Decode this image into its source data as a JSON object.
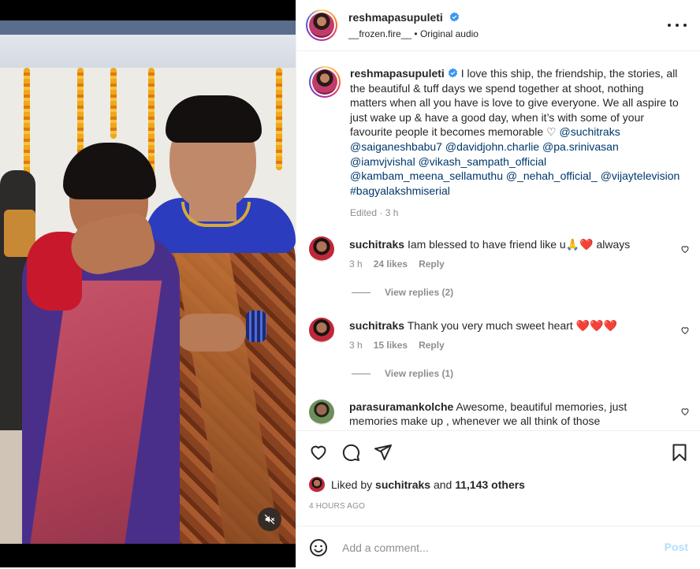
{
  "post": {
    "username": "reshmapasupuleti",
    "audio_user": "__frozen.fire__",
    "audio_sep": " • ",
    "audio_label": "Original audio",
    "caption_parts": [
      {
        "t": "I love this ship, the friendship, the stories, all the beautiful & tuff days we spend together at shoot, nothing matters when all you have is love to give everyone. We all aspire to just wake up & have a good day, when it’s with some of your favourite people it becomes memorable ",
        "tag": false
      },
      {
        "t": "♡ ",
        "tag": false
      },
      {
        "t": "@suchitraks",
        "tag": true
      },
      {
        "t": " ",
        "tag": false
      },
      {
        "t": "@saiganeshbabu7",
        "tag": true
      },
      {
        "t": " ",
        "tag": false
      },
      {
        "t": "@davidjohn.charlie",
        "tag": true
      },
      {
        "t": " ",
        "tag": false
      },
      {
        "t": "@pa.srinivasan",
        "tag": true
      },
      {
        "t": " ",
        "tag": false
      },
      {
        "t": "@iamvjvishal",
        "tag": true
      },
      {
        "t": " ",
        "tag": false
      },
      {
        "t": "@vikash_sampath_official",
        "tag": true
      },
      {
        "t": " ",
        "tag": false
      },
      {
        "t": "@kambam_meena_sellamuthu",
        "tag": true
      },
      {
        "t": " ",
        "tag": false
      },
      {
        "t": "@_nehah_official_",
        "tag": true
      },
      {
        "t": " ",
        "tag": false
      },
      {
        "t": "@vijaytelevision",
        "tag": true
      },
      {
        "t": " ",
        "tag": false
      },
      {
        "t": "#bagyalakshmiserial",
        "tag": true
      }
    ],
    "caption_meta": "Edited · 3 h"
  },
  "comments": [
    {
      "user": "suchitraks",
      "text": "Iam blessed to have friend like u🙏❤️ always",
      "time": "3 h",
      "likes": "24 likes",
      "reply": "Reply",
      "view_replies": "View replies (2)"
    },
    {
      "user": "suchitraks",
      "text": "Thank you very much sweet heart ❤️❤️❤️",
      "time": "3 h",
      "likes": "15 likes",
      "reply": "Reply",
      "view_replies": "View replies (1)"
    },
    {
      "user": "parasuramankolche",
      "text": "Awesome, beautiful memories, just memories make up , whenever we all think of those",
      "time": "",
      "likes": "",
      "reply": "",
      "view_replies": ""
    }
  ],
  "likes": {
    "prefix": "Liked by ",
    "user": "suchitraks",
    "mid": " and ",
    "count": "11,143 others"
  },
  "time_ago": "4 HOURS AGO",
  "composer": {
    "placeholder": "Add a comment...",
    "post_label": "Post"
  },
  "icons": {
    "mute": "speaker-muted-icon",
    "more": "more-options-icon",
    "like": "heart-icon",
    "comment": "comment-bubble-icon",
    "share": "paper-plane-icon",
    "save": "bookmark-icon",
    "emoji": "emoji-smile-icon",
    "verified": "verified-badge-icon"
  },
  "colors": {
    "link": "#00376b",
    "muted": "#8e8e8e",
    "verified": "#3897f0",
    "post_disabled": "#b2dffc"
  }
}
